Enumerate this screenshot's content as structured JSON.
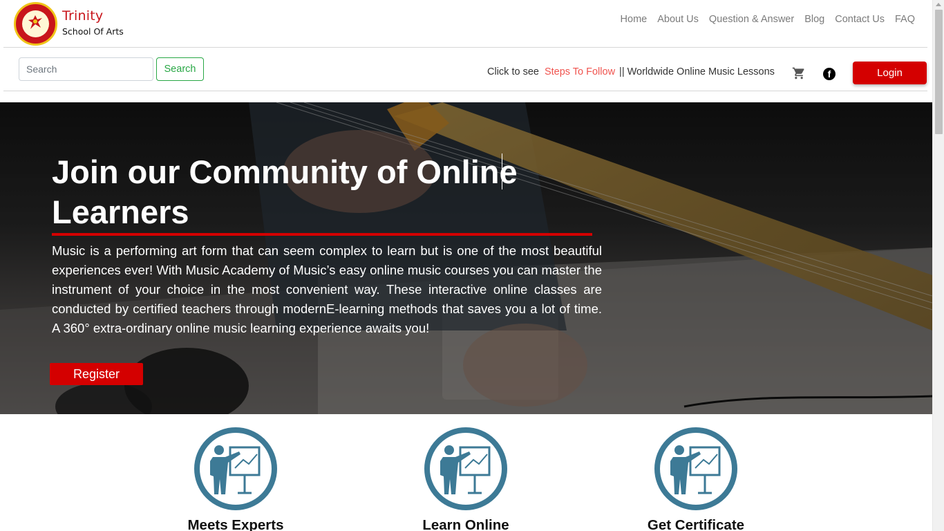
{
  "brand": {
    "name_line1": "Trinity",
    "name_line2": "School Of Arts",
    "logo_icon": "school-crest-logo"
  },
  "nav": {
    "items": [
      {
        "label": "Home"
      },
      {
        "label": "About Us"
      },
      {
        "label": "Question & Answer"
      },
      {
        "label": "Blog"
      },
      {
        "label": "Contact Us"
      },
      {
        "label": "FAQ"
      }
    ]
  },
  "search": {
    "placeholder": "Search",
    "value": "",
    "button_label": "Search"
  },
  "info": {
    "prefix": "Click to see",
    "link_label": "Steps To Follow",
    "suffix": "|| Worldwide Online Music Lessons"
  },
  "header_actions": {
    "cart_icon": "cart-icon",
    "facebook_icon": "facebook-icon",
    "facebook_glyph": "f",
    "login_label": "Login"
  },
  "hero": {
    "title": "Join our Community of Online Learners",
    "text": "Music is a performing art form that can seem complex to learn but is one of the most beautiful experiences ever! With Music Academy of Music’s easy online music courses you can master the instrument of your choice in the most convenient way. These interactive online classes are conducted by certified teachers through modernE-learning methods that saves you a lot of time. A 360° extra-ordinary online music learning experience awaits you!",
    "register_label": "Register"
  },
  "features": [
    {
      "label": "Meets Experts",
      "icon": "teacher-board-icon"
    },
    {
      "label": "Learn Online",
      "icon": "teacher-board-icon"
    },
    {
      "label": "Get Certificate",
      "icon": "teacher-board-icon"
    }
  ],
  "colors": {
    "accent_red": "#d40000",
    "brand_red": "#c8151b",
    "search_green": "#28a745",
    "link_coral": "#f0544f",
    "icon_teal": "#3d7a96"
  }
}
